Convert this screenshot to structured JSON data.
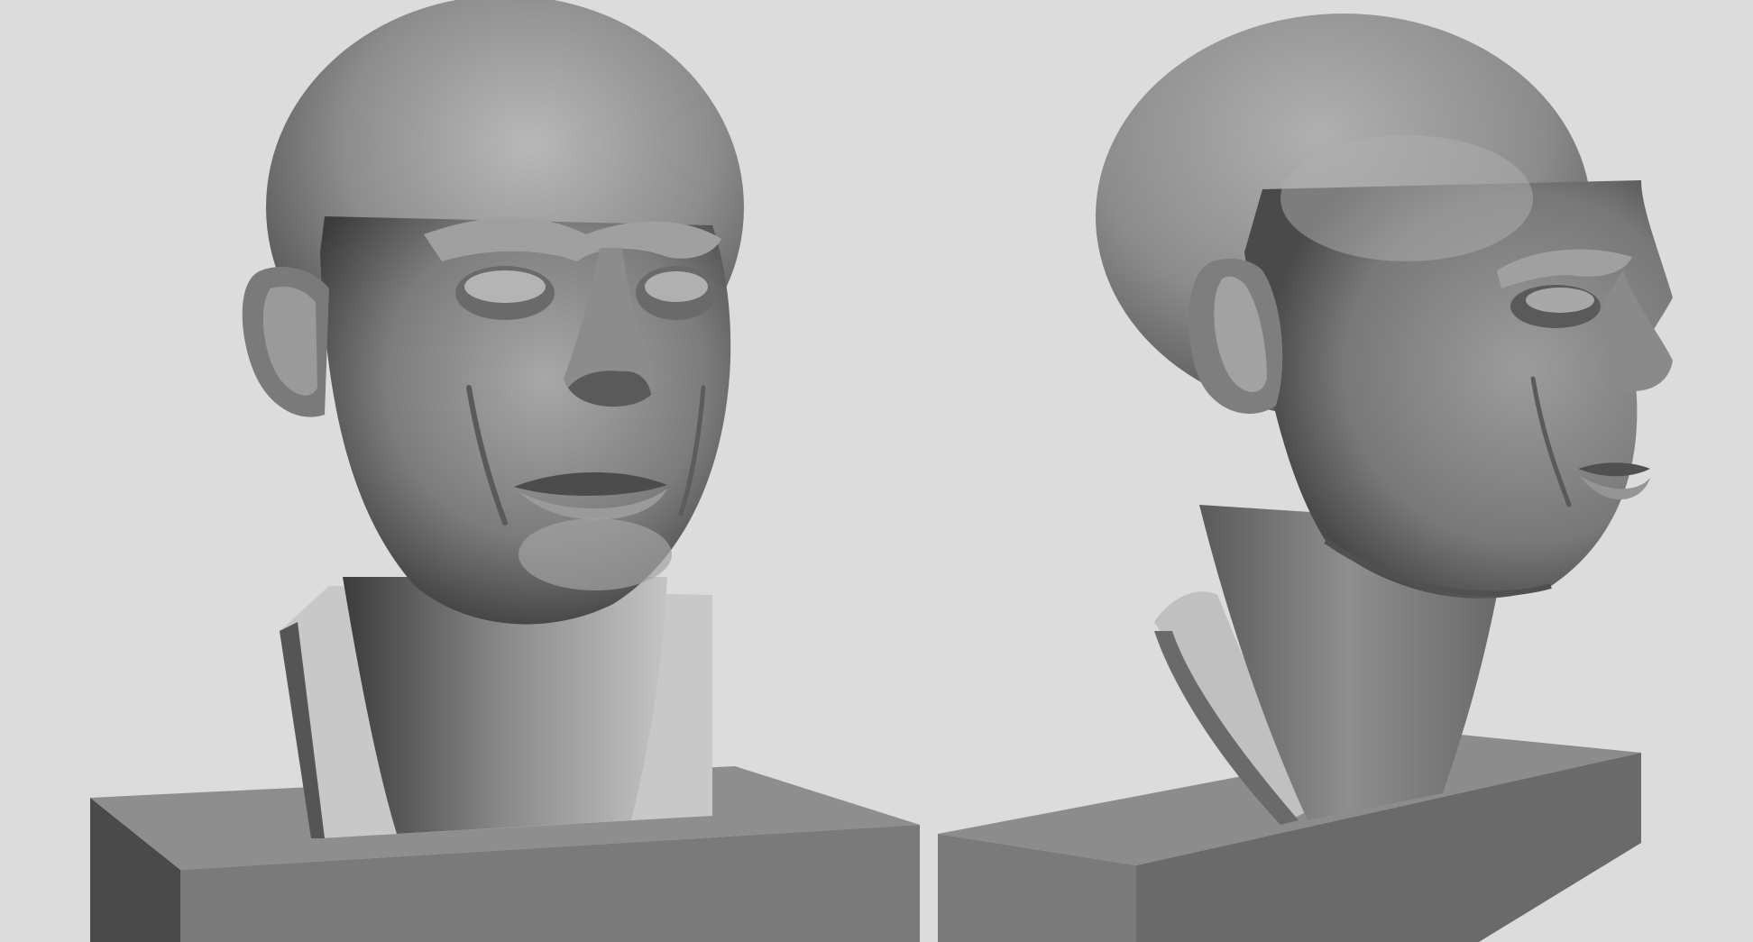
{
  "scene": {
    "background_color": "#dcdcdc",
    "material_color": "#8a8a8a",
    "views": [
      {
        "name": "three-quarter-front",
        "subject": "male-head-bust",
        "pedestal": "rectangular-block"
      },
      {
        "name": "profile-right",
        "subject": "male-head-bust",
        "pedestal": "rectangular-block"
      }
    ]
  }
}
